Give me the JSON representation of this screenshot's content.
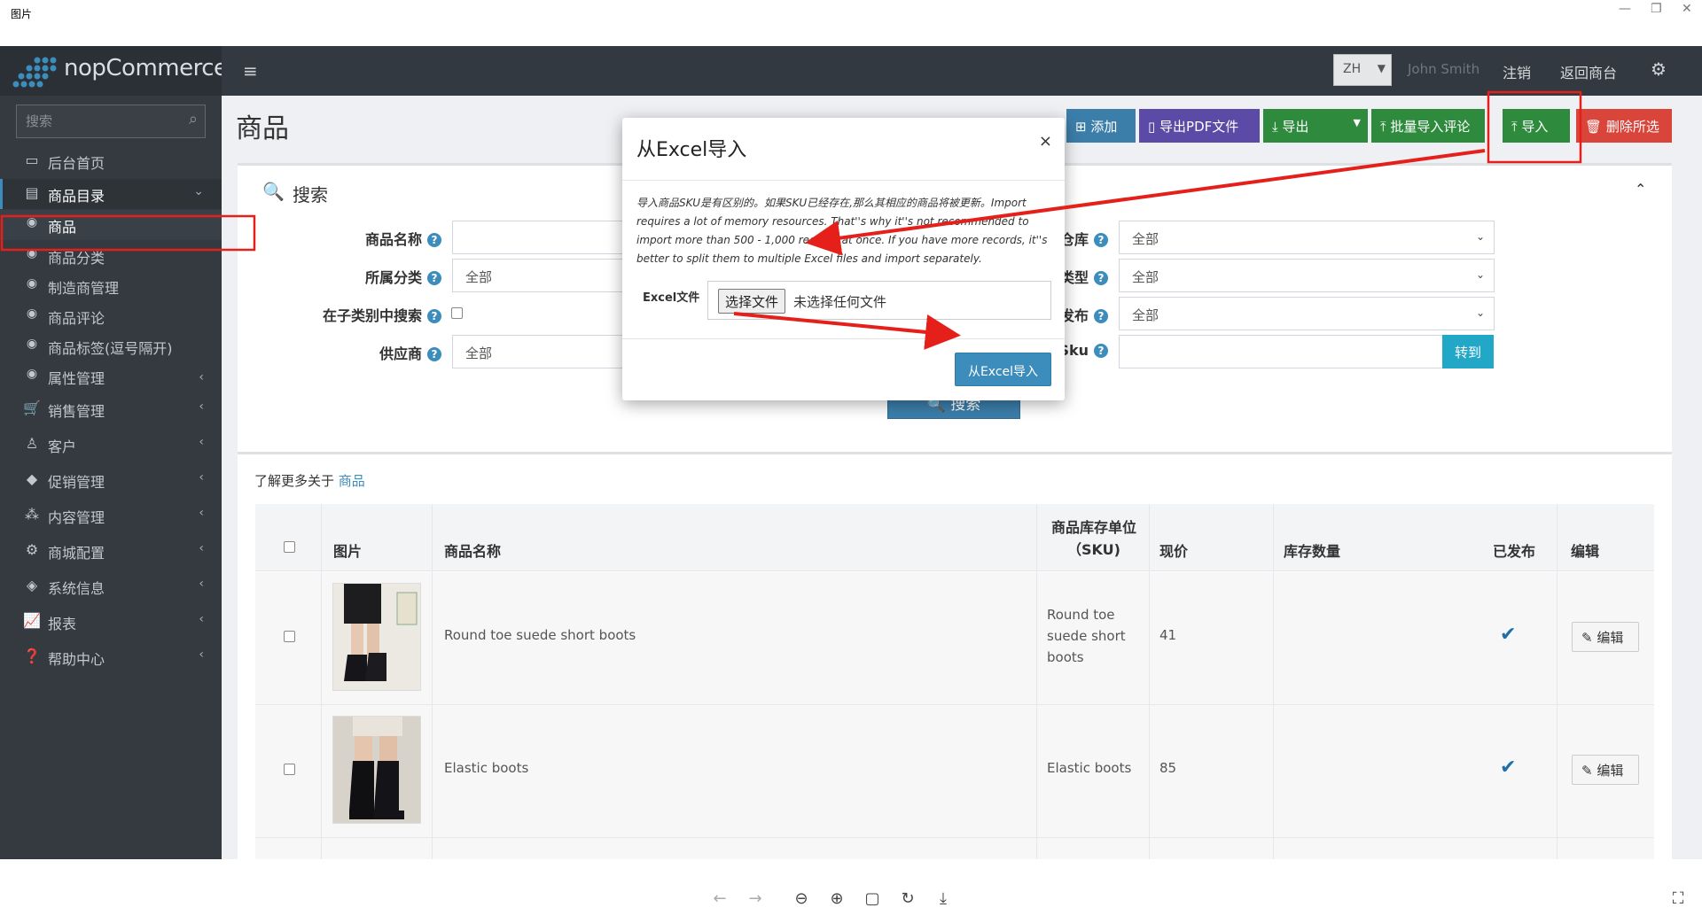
{
  "viewer": {
    "title": "图片",
    "controls": [
      "←",
      "→",
      "⊖",
      "⊕",
      "▢",
      "↻",
      "⤓",
      "⛶"
    ]
  },
  "topbar": {
    "logo": "nopCommerce",
    "lang": "ZH",
    "user": "John Smith",
    "logout": "注销",
    "back_to_store": "返回商台"
  },
  "sidebar": {
    "search_placeholder": "搜索",
    "items": [
      {
        "label": "后台首页",
        "icon": "monitor-icon"
      },
      {
        "label": "商品目录",
        "icon": "book-icon"
      },
      {
        "label": "商品",
        "icon": "circle-dot-icon"
      },
      {
        "label": "商品分类",
        "icon": "circle-dot-icon"
      },
      {
        "label": "制造商管理",
        "icon": "circle-dot-icon"
      },
      {
        "label": "商品评论",
        "icon": "circle-dot-icon"
      },
      {
        "label": "商品标签(逗号隔开)",
        "icon": "circle-dot-icon"
      },
      {
        "label": "属性管理",
        "icon": "circle-dot-icon"
      },
      {
        "label": "销售管理",
        "icon": "cart-icon"
      },
      {
        "label": "客户",
        "icon": "user-icon"
      },
      {
        "label": "促销管理",
        "icon": "tags-icon"
      },
      {
        "label": "内容管理",
        "icon": "cubes-icon"
      },
      {
        "label": "商城配置",
        "icon": "gears-icon"
      },
      {
        "label": "系统信息",
        "icon": "cube-icon"
      },
      {
        "label": "报表",
        "icon": "chart-icon"
      },
      {
        "label": "帮助中心",
        "icon": "question-icon"
      }
    ]
  },
  "page": {
    "title": "商品",
    "buttons": {
      "add": "添加",
      "export_pdf": "导出PDF文件",
      "export": "导出",
      "bulk_import_reviews": "批量导入评论",
      "import": "导入",
      "delete_selected": "删除所选"
    }
  },
  "search": {
    "heading": "搜索",
    "labels": {
      "product_name": "商品名称",
      "category": "所属分类",
      "search_subcategories": "在子类别中搜索",
      "vendor": "供应商",
      "warehouse": "仓库",
      "product_type": "类型",
      "published": "发布",
      "sku": "Sku"
    },
    "values": {
      "category": "全部",
      "vendor": "全部",
      "warehouse": "全部",
      "product_type": "全部",
      "published": "全部"
    },
    "goto": "转到",
    "search_button": "搜索"
  },
  "learn_more": {
    "text": "了解更多关于",
    "link": "商品"
  },
  "table": {
    "headers": {
      "picture": "图片",
      "name": "商品名称",
      "sku": "商品库存单位（SKU)",
      "price": "现价",
      "stock": "库存数量",
      "published": "已发布",
      "edit": "编辑"
    },
    "rows": [
      {
        "name": "Round toe suede short boots",
        "sku": "Round toe suede short boots",
        "price": "41",
        "stock": "",
        "published": true,
        "edit": "编辑"
      },
      {
        "name": "Elastic boots",
        "sku": "Elastic boots",
        "price": "85",
        "stock": "",
        "published": true,
        "edit": "编辑"
      }
    ]
  },
  "modal": {
    "title": "从Excel导入",
    "close": "×",
    "note": "导入商品SKU是有区别的。如果SKU已经存在,那么其相应的商品将被更新。Import requires a lot of memory resources. That''s why it''s not recommended to import more than 500 - 1,000 records at once. If you have more records, it''s better to split them to multiple Excel files and import separately.",
    "file_label": "Excel文件",
    "choose_file": "选择文件",
    "no_file": "未选择任何文件",
    "import_button": "从Excel导入"
  },
  "colors": {
    "topbar": "#323940",
    "sidebar": "#343a40",
    "primary": "#3c8dbc",
    "btn_green": "#2e8b3d",
    "btn_purple": "#5b4aa6",
    "btn_red": "#d9453b",
    "annotation": "#e5201b"
  }
}
